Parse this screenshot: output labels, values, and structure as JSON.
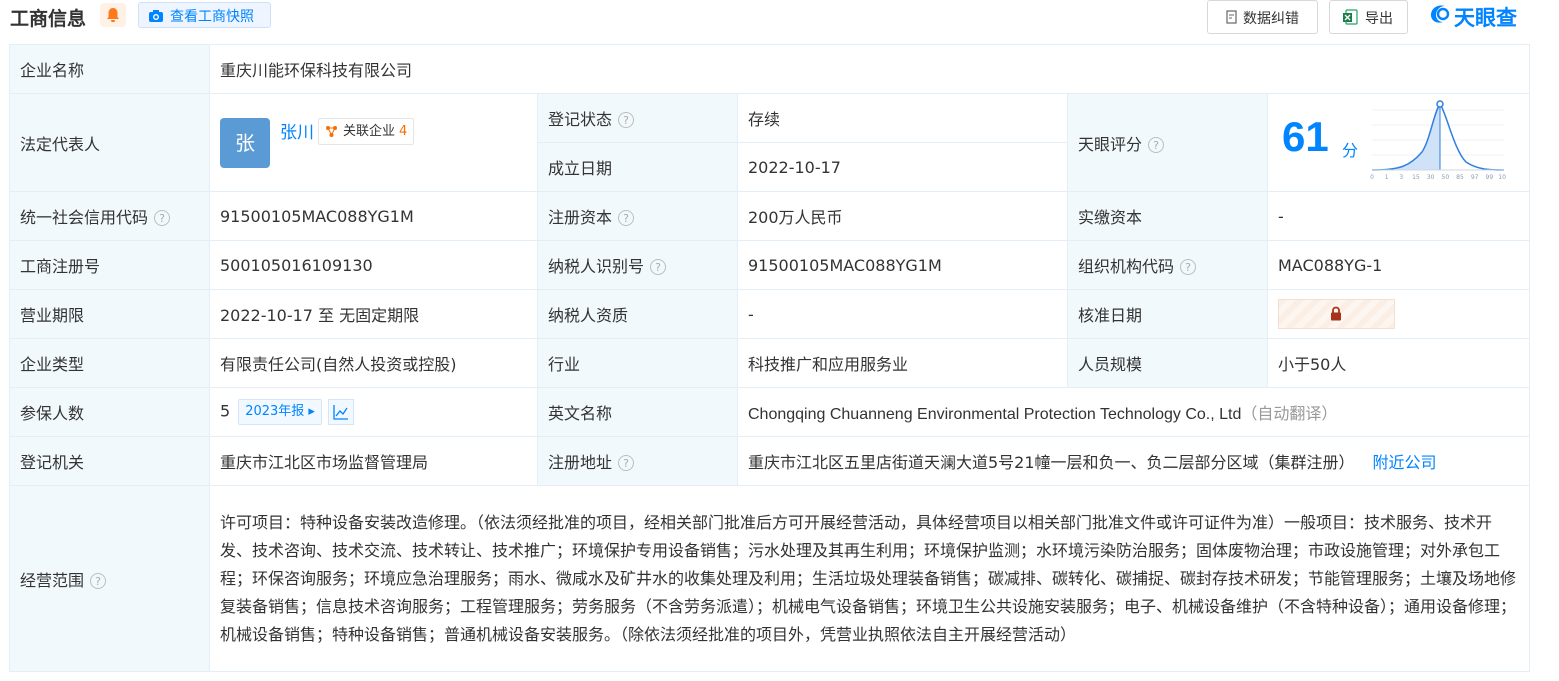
{
  "header": {
    "title": "工商信息",
    "snapshot_label": "查看工商快照",
    "data_fix_label": "数据纠错",
    "export_label": "导出",
    "brand": "天眼查"
  },
  "rows": {
    "company_name": {
      "label": "企业名称",
      "value": "重庆川能环保科技有限公司"
    },
    "legal_rep": {
      "label": "法定代表人",
      "avatar_char": "张",
      "name": "张川",
      "assoc_label": "关联企业",
      "assoc_count": "4"
    },
    "reg_status": {
      "label": "登记状态",
      "value": "存续"
    },
    "found_date": {
      "label": "成立日期",
      "value": "2022-10-17"
    },
    "tianyan_score": {
      "label": "天眼评分",
      "score": "61",
      "unit": "分",
      "axis_ticks": [
        "0",
        "1",
        "3",
        "15",
        "30",
        "50",
        "85",
        "97",
        "99",
        "100"
      ]
    },
    "credit_code": {
      "label": "统一社会信用代码",
      "value": "91500105MAC088YG1M"
    },
    "reg_capital": {
      "label": "注册资本",
      "value": "200万人民币"
    },
    "paid_capital": {
      "label": "实缴资本",
      "value": "-"
    },
    "reg_number": {
      "label": "工商注册号",
      "value": "500105016109130"
    },
    "taxpayer_id": {
      "label": "纳税人识别号",
      "value": "91500105MAC088YG1M"
    },
    "org_code": {
      "label": "组织机构代码",
      "value": "MAC088YG-1"
    },
    "biz_term": {
      "label": "营业期限",
      "value": "2022-10-17 至 无固定期限"
    },
    "taxpayer_qual": {
      "label": "纳税人资质",
      "value": "-"
    },
    "approval_date": {
      "label": "核准日期"
    },
    "company_type": {
      "label": "企业类型",
      "value": "有限责任公司(自然人投资或控股)"
    },
    "industry": {
      "label": "行业",
      "value": "科技推广和应用服务业"
    },
    "staff_size": {
      "label": "人员规模",
      "value": "小于50人"
    },
    "insured": {
      "label": "参保人数",
      "value": "5",
      "year_tag": "2023年报"
    },
    "english_name": {
      "label": "英文名称",
      "value": "Chongqing Chuanneng Environmental Protection Technology Co., Ltd",
      "note": "（自动翻译）"
    },
    "reg_authority": {
      "label": "登记机关",
      "value": "重庆市江北区市场监督管理局"
    },
    "reg_address": {
      "label": "注册地址",
      "value": "重庆市江北区五里店街道天澜大道5号21幢一层和负一、负二层部分区域（集群注册）",
      "link": "附近公司"
    },
    "biz_scope": {
      "label": "经营范围",
      "value": "许可项目：特种设备安装改造修理。（依法须经批准的项目，经相关部门批准后方可开展经营活动，具体经营项目以相关部门批准文件或许可证件为准）一般项目：技术服务、技术开发、技术咨询、技术交流、技术转让、技术推广；环境保护专用设备销售；污水处理及其再生利用；环境保护监测；水环境污染防治服务；固体废物治理；市政设施管理；对外承包工程；环保咨询服务；环境应急治理服务；雨水、微咸水及矿井水的收集处理及利用；生活垃圾处理装备销售；碳减排、碳转化、碳捕捉、碳封存技术研发；节能管理服务；土壤及场地修复装备销售；信息技术咨询服务；工程管理服务；劳务服务（不含劳务派遣）；机械电气设备销售；环境卫生公共设施安装服务；电子、机械设备维护（不含特种设备）；通用设备修理；机械设备销售；特种设备销售；普通机械设备安装服务。（除依法须经批准的项目外，凭营业执照依法自主开展经营活动）"
    }
  }
}
